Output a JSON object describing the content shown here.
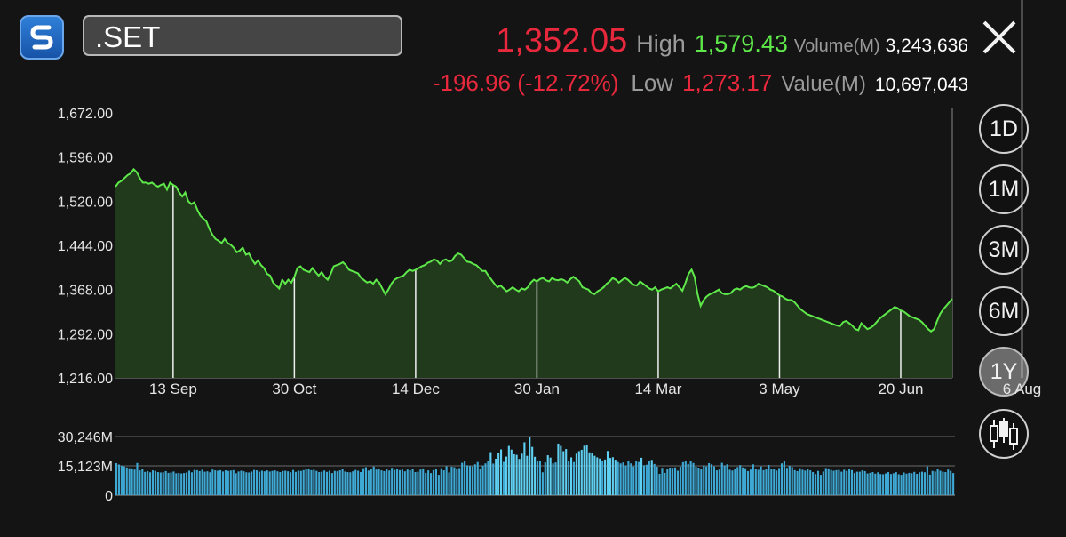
{
  "header": {
    "symbol": ".SET",
    "last_price": "1,352.05",
    "change": "-196.96 (-12.72%)",
    "high_label": "High",
    "high_value": "1,579.43",
    "low_label": "Low",
    "low_value": "1,273.17",
    "volume_label": "Volume(M)",
    "volume_value": "3,243,636",
    "value_label": "Value(M)",
    "value_value": "10,697,043"
  },
  "ranges": [
    "1D",
    "1M",
    "3M",
    "6M",
    "1Y"
  ],
  "active_range": "1Y",
  "colors": {
    "line": "#5ee84a",
    "area_fill": "#213a1c",
    "volume_bar": "#3fa9d6",
    "volume_bar_highlight": "#5fd0f2",
    "negative": "#e8283c",
    "positive": "#5ee84a"
  },
  "icons": [
    "app-logo-icon",
    "close-icon",
    "candlestick-icon"
  ],
  "chart_data": [
    {
      "type": "area",
      "ylim": [
        1216.0,
        1672.0
      ],
      "y_ticks": [
        "1,672.00",
        "1,596.00",
        "1,520.00",
        "1,444.00",
        "1,368.00",
        "1,292.00",
        "1,216.00"
      ],
      "x_ticks": [
        "13 Sep",
        "30 Oct",
        "14 Dec",
        "30 Jan",
        "14 Mar",
        "3 May",
        "20 Jun",
        "6 Aug"
      ],
      "x_tick_index": [
        19,
        59,
        99,
        139,
        179,
        219,
        259,
        299
      ],
      "values": [
        1545,
        1552,
        1555,
        1560,
        1565,
        1568,
        1575,
        1570,
        1560,
        1552,
        1552,
        1550,
        1552,
        1548,
        1545,
        1548,
        1550,
        1540,
        1552,
        1548,
        1545,
        1535,
        1528,
        1535,
        1520,
        1515,
        1518,
        1505,
        1495,
        1490,
        1485,
        1472,
        1462,
        1455,
        1452,
        1448,
        1455,
        1448,
        1445,
        1440,
        1432,
        1435,
        1440,
        1428,
        1430,
        1420,
        1412,
        1418,
        1410,
        1405,
        1395,
        1392,
        1380,
        1375,
        1370,
        1385,
        1378,
        1385,
        1380,
        1390,
        1405,
        1408,
        1402,
        1400,
        1398,
        1405,
        1398,
        1392,
        1398,
        1390,
        1385,
        1395,
        1408,
        1410,
        1412,
        1415,
        1410,
        1402,
        1400,
        1398,
        1396,
        1388,
        1384,
        1380,
        1382,
        1378,
        1385,
        1380,
        1370,
        1360,
        1368,
        1378,
        1385,
        1388,
        1390,
        1392,
        1398,
        1402,
        1400,
        1402,
        1405,
        1408,
        1410,
        1414,
        1416,
        1420,
        1418,
        1412,
        1418,
        1420,
        1416,
        1418,
        1426,
        1430,
        1428,
        1422,
        1416,
        1415,
        1412,
        1410,
        1405,
        1400,
        1400,
        1392,
        1385,
        1378,
        1372,
        1375,
        1370,
        1365,
        1368,
        1372,
        1368,
        1365,
        1370,
        1368,
        1372,
        1380,
        1385,
        1382,
        1386,
        1388,
        1384,
        1382,
        1388,
        1385,
        1384,
        1386,
        1384,
        1380,
        1386,
        1390,
        1386,
        1382,
        1372,
        1370,
        1368,
        1362,
        1360,
        1365,
        1368,
        1372,
        1378,
        1382,
        1388,
        1385,
        1380,
        1384,
        1388,
        1385,
        1380,
        1376,
        1375,
        1382,
        1378,
        1374,
        1370,
        1368,
        1372,
        1365,
        1368,
        1370,
        1372,
        1370,
        1374,
        1378,
        1372,
        1366,
        1380,
        1395,
        1402,
        1390,
        1360,
        1340,
        1350,
        1356,
        1360,
        1362,
        1365,
        1368,
        1362,
        1360,
        1360,
        1362,
        1368,
        1370,
        1368,
        1372,
        1374,
        1372,
        1371,
        1373,
        1378,
        1376,
        1374,
        1372,
        1368,
        1366,
        1362,
        1358,
        1356,
        1352,
        1350,
        1350,
        1346,
        1340,
        1334,
        1330,
        1326,
        1324,
        1322,
        1320,
        1318,
        1316,
        1314,
        1312,
        1310,
        1308,
        1306,
        1305,
        1312,
        1314,
        1310,
        1306,
        1300,
        1298,
        1310,
        1305,
        1300,
        1302,
        1306,
        1312,
        1318,
        1322,
        1326,
        1330,
        1334,
        1338,
        1336,
        1332,
        1330,
        1326,
        1322,
        1320,
        1318,
        1316,
        1312,
        1306,
        1300,
        1296,
        1300,
        1314,
        1326,
        1334,
        1340,
        1346,
        1352
      ],
      "line_color": "#5ee84a"
    },
    {
      "type": "bar",
      "ylim": [
        0,
        30246
      ],
      "y_ticks": [
        "30,246M",
        "15,123M",
        "0"
      ],
      "highlight_threshold": 18000,
      "values": [
        16500,
        15800,
        15200,
        14800,
        14300,
        13900,
        13800,
        13200,
        16600,
        12800,
        13600,
        12000,
        12400,
        11800,
        12800,
        12500,
        11900,
        11700,
        11800,
        12400,
        11500,
        11700,
        12200,
        11300,
        11500,
        11200,
        11400,
        11700,
        12600,
        11800,
        13000,
        12900,
        12400,
        13100,
        12100,
        12300,
        11800,
        13200,
        12800,
        12600,
        12900,
        12200,
        12800,
        12500,
        12700,
        12900,
        11300,
        12200,
        12600,
        12300,
        11800,
        11700,
        12200,
        13000,
        12800,
        12100,
        12600,
        12300,
        12800,
        12200,
        12500,
        12800,
        12300,
        11900,
        12500,
        12600,
        12300,
        11800,
        13000,
        12000,
        12600,
        12500,
        12900,
        13400,
        13700,
        12900,
        13100,
        12500,
        11900,
        12100,
        12700,
        12000,
        12600,
        11400,
        12500,
        12300,
        12800,
        13300,
        12200,
        11900,
        11800,
        12300,
        13000,
        12600,
        11900,
        13900,
        14400,
        12700,
        13300,
        14800,
        13200,
        13700,
        12800,
        12400,
        13700,
        12700,
        14100,
        13000,
        13500,
        12900,
        13200,
        12300,
        13200,
        12800,
        13700,
        11900,
        12100,
        13200,
        13800,
        11500,
        12800,
        11400,
        12900,
        13400,
        10500,
        13900,
        12800,
        14900,
        11700,
        14700,
        14400,
        13800,
        14000,
        16700,
        17500,
        15400,
        15200,
        14800,
        15900,
        17100,
        13700,
        15300,
        16400,
        17600,
        22200,
        16300,
        18800,
        21600,
        23600,
        17200,
        19900,
        25400,
        23500,
        21100,
        20800,
        18700,
        21400,
        27300,
        20300,
        30400,
        24900,
        19800,
        17600,
        17900,
        11800,
        16900,
        20600,
        19400,
        16400,
        16900,
        26600,
        25400,
        22700,
        23800,
        17800,
        19500,
        17100,
        21400,
        22700,
        23400,
        25500,
        25800,
        22100,
        21600,
        20300,
        19500,
        18900,
        17900,
        18400,
        22800,
        19200,
        19600,
        18300,
        17100,
        16400,
        16900,
        15300,
        17600,
        16400,
        14800,
        17400,
        17100,
        19300,
        15400,
        15700,
        17800,
        18200,
        16100,
        14700,
        11000,
        14100,
        11500,
        13300,
        14200,
        14100,
        14300,
        12600,
        14700,
        17000,
        17700,
        16100,
        17800,
        16600,
        14700,
        14200,
        13400,
        15300,
        14800,
        16500,
        15900,
        14800,
        12800,
        13200,
        16700,
        15300,
        15900,
        13100,
        12700,
        13500,
        14500,
        15500,
        14300,
        13900,
        12400,
        13200,
        15900,
        13300,
        13100,
        14800,
        12900,
        13700,
        15600,
        13700,
        13300,
        12700,
        14000,
        16400,
        17400,
        14100,
        15100,
        14500,
        12900,
        12400,
        13900,
        13100,
        12700,
        13300,
        12800,
        11900,
        10900,
        12500,
        10500,
        12200,
        14000,
        13800,
        13000,
        12600,
        12900,
        13000,
        12100,
        13100,
        12500,
        13400,
        12900,
        11400,
        12100,
        12100,
        12800,
        12400,
        11200,
        11500,
        11900,
        11100,
        11800,
        10900,
        10800,
        11200,
        11900,
        10900,
        11300,
        11900,
        10800,
        10500,
        11700,
        11100,
        11500,
        11300,
        12000,
        11000,
        11800,
        12100,
        11800,
        14800,
        10600,
        12500,
        12200,
        13400,
        12600,
        12100,
        11900,
        13200,
        12500,
        11400
      ]
    }
  ]
}
